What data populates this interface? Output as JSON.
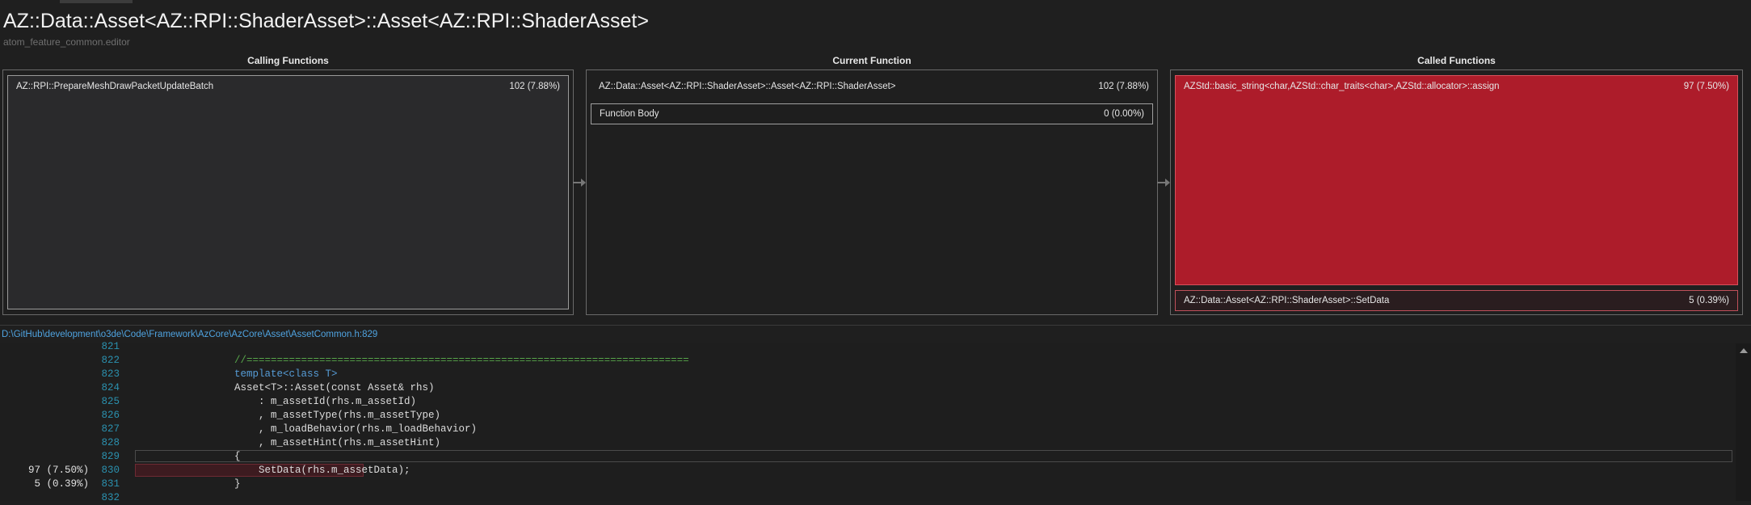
{
  "header": {
    "title": "AZ::Data::Asset<AZ::RPI::ShaderAsset>::Asset<AZ::RPI::ShaderAsset>",
    "module": "atom_feature_common.editor"
  },
  "calling": {
    "heading": "Calling Functions",
    "items": [
      {
        "name": "AZ::RPI::PrepareMeshDrawPacketUpdateBatch",
        "value": "102 (7.88%)"
      }
    ]
  },
  "current": {
    "heading": "Current Function",
    "name": "AZ::Data::Asset<AZ::RPI::ShaderAsset>::Asset<AZ::RPI::ShaderAsset>",
    "value": "102 (7.88%)",
    "body_label": "Function Body",
    "body_value": "0 (0.00%)"
  },
  "called": {
    "heading": "Called Functions",
    "items": [
      {
        "name": "AZStd::basic_string<char,AZStd::char_traits<char>,AZStd::allocator>::assign",
        "value": "97 (7.50%)"
      },
      {
        "name": "AZ::Data::Asset<AZ::RPI::ShaderAsset>::SetData",
        "value": "5 (0.39%)"
      }
    ]
  },
  "source": {
    "path": "D:\\GitHub\\development\\o3de\\Code\\Framework\\AzCore\\AzCore\\Asset\\AssetCommon.h:829",
    "lines": [
      {
        "n": "821",
        "count": "",
        "code": ""
      },
      {
        "n": "822",
        "count": "",
        "code": "        //========================================================================="
      },
      {
        "n": "823",
        "count": "",
        "code": "        template<class T>"
      },
      {
        "n": "824",
        "count": "",
        "code": "        Asset<T>::Asset(const Asset& rhs)"
      },
      {
        "n": "825",
        "count": "",
        "code": "            : m_assetId(rhs.m_assetId)"
      },
      {
        "n": "826",
        "count": "",
        "code": "            , m_assetType(rhs.m_assetType)"
      },
      {
        "n": "827",
        "count": "",
        "code": "            , m_loadBehavior(rhs.m_loadBehavior)"
      },
      {
        "n": "828",
        "count": "",
        "code": "            , m_assetHint(rhs.m_assetHint)"
      },
      {
        "n": "829",
        "count": "",
        "code": "        {"
      },
      {
        "n": "830",
        "count": "97 (7.50%)",
        "code": "            SetData(rhs.m_assetData);"
      },
      {
        "n": "831",
        "count": "5 (0.39%)",
        "code": "        }"
      },
      {
        "n": "832",
        "count": "",
        "code": ""
      }
    ]
  },
  "colors": {
    "hot": "#ad1c2a",
    "hot_border": "#d8505c",
    "link": "#4fa3e0",
    "line_number": "#2b91af",
    "comment": "#57a64a",
    "keyword": "#569cd6"
  }
}
